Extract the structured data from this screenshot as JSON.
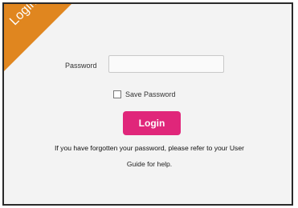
{
  "corner_ribbon": {
    "label": "Login",
    "color": "#e0861f"
  },
  "form": {
    "password_label": "Password",
    "password_value": "",
    "save_password_label": "Save Password",
    "save_password_checked": false,
    "login_button_label": "Login",
    "login_button_color": "#e0267a"
  },
  "help": {
    "line1": "If you have forgotten your password, please refer to your User",
    "line2": "Guide for help."
  }
}
